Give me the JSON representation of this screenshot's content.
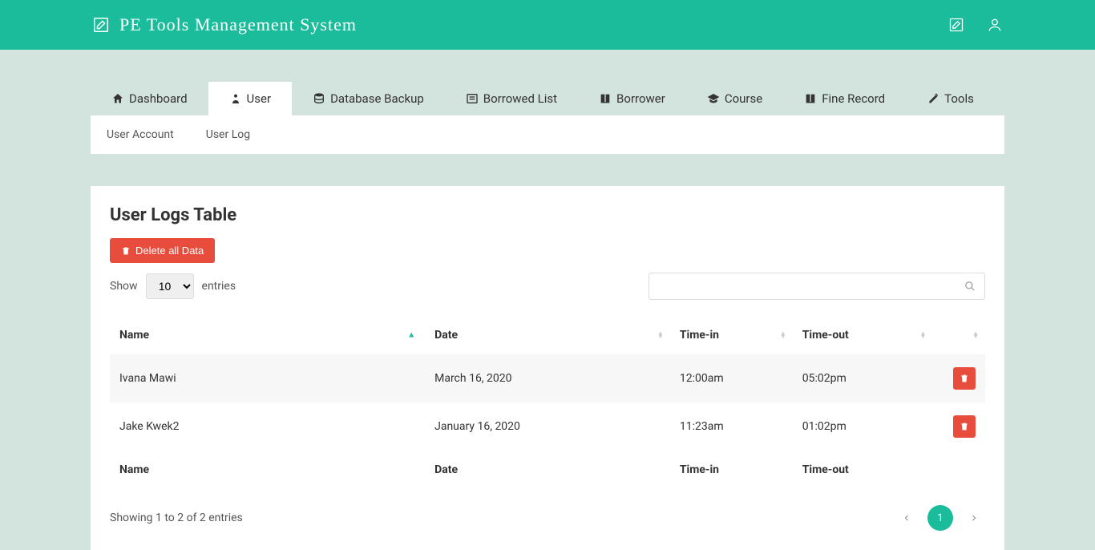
{
  "header": {
    "title": "PE  Tools  Management  System"
  },
  "nav": [
    {
      "icon": "home-icon",
      "label": "Dashboard"
    },
    {
      "icon": "user-icon",
      "label": "User"
    },
    {
      "icon": "database-icon",
      "label": "Database Backup"
    },
    {
      "icon": "list-icon",
      "label": "Borrowed List"
    },
    {
      "icon": "book-icon",
      "label": "Borrower"
    },
    {
      "icon": "graduation-icon",
      "label": "Course"
    },
    {
      "icon": "book-icon",
      "label": "Fine Record"
    },
    {
      "icon": "wrench-icon",
      "label": "Tools"
    }
  ],
  "sub_tabs": [
    "User Account",
    "User Log"
  ],
  "panel": {
    "title": "User Logs Table",
    "delete_all_label": "Delete all Data",
    "show_label": "Show",
    "entries_label": "entries",
    "page_size": "10",
    "columns": [
      "Name",
      "Date",
      "Time-in",
      "Time-out"
    ],
    "rows": [
      {
        "name": "Ivana Mawi",
        "date": "March 16, 2020",
        "time_in": "12:00am",
        "time_out": "05:02pm"
      },
      {
        "name": "Jake Kwek2",
        "date": "January 16, 2020",
        "time_in": "11:23am",
        "time_out": "01:02pm"
      }
    ],
    "footer_columns": [
      "Name",
      "Date",
      "Time-in",
      "Time-out"
    ],
    "info": "Showing 1 to 2 of 2 entries",
    "page_current": "1"
  }
}
